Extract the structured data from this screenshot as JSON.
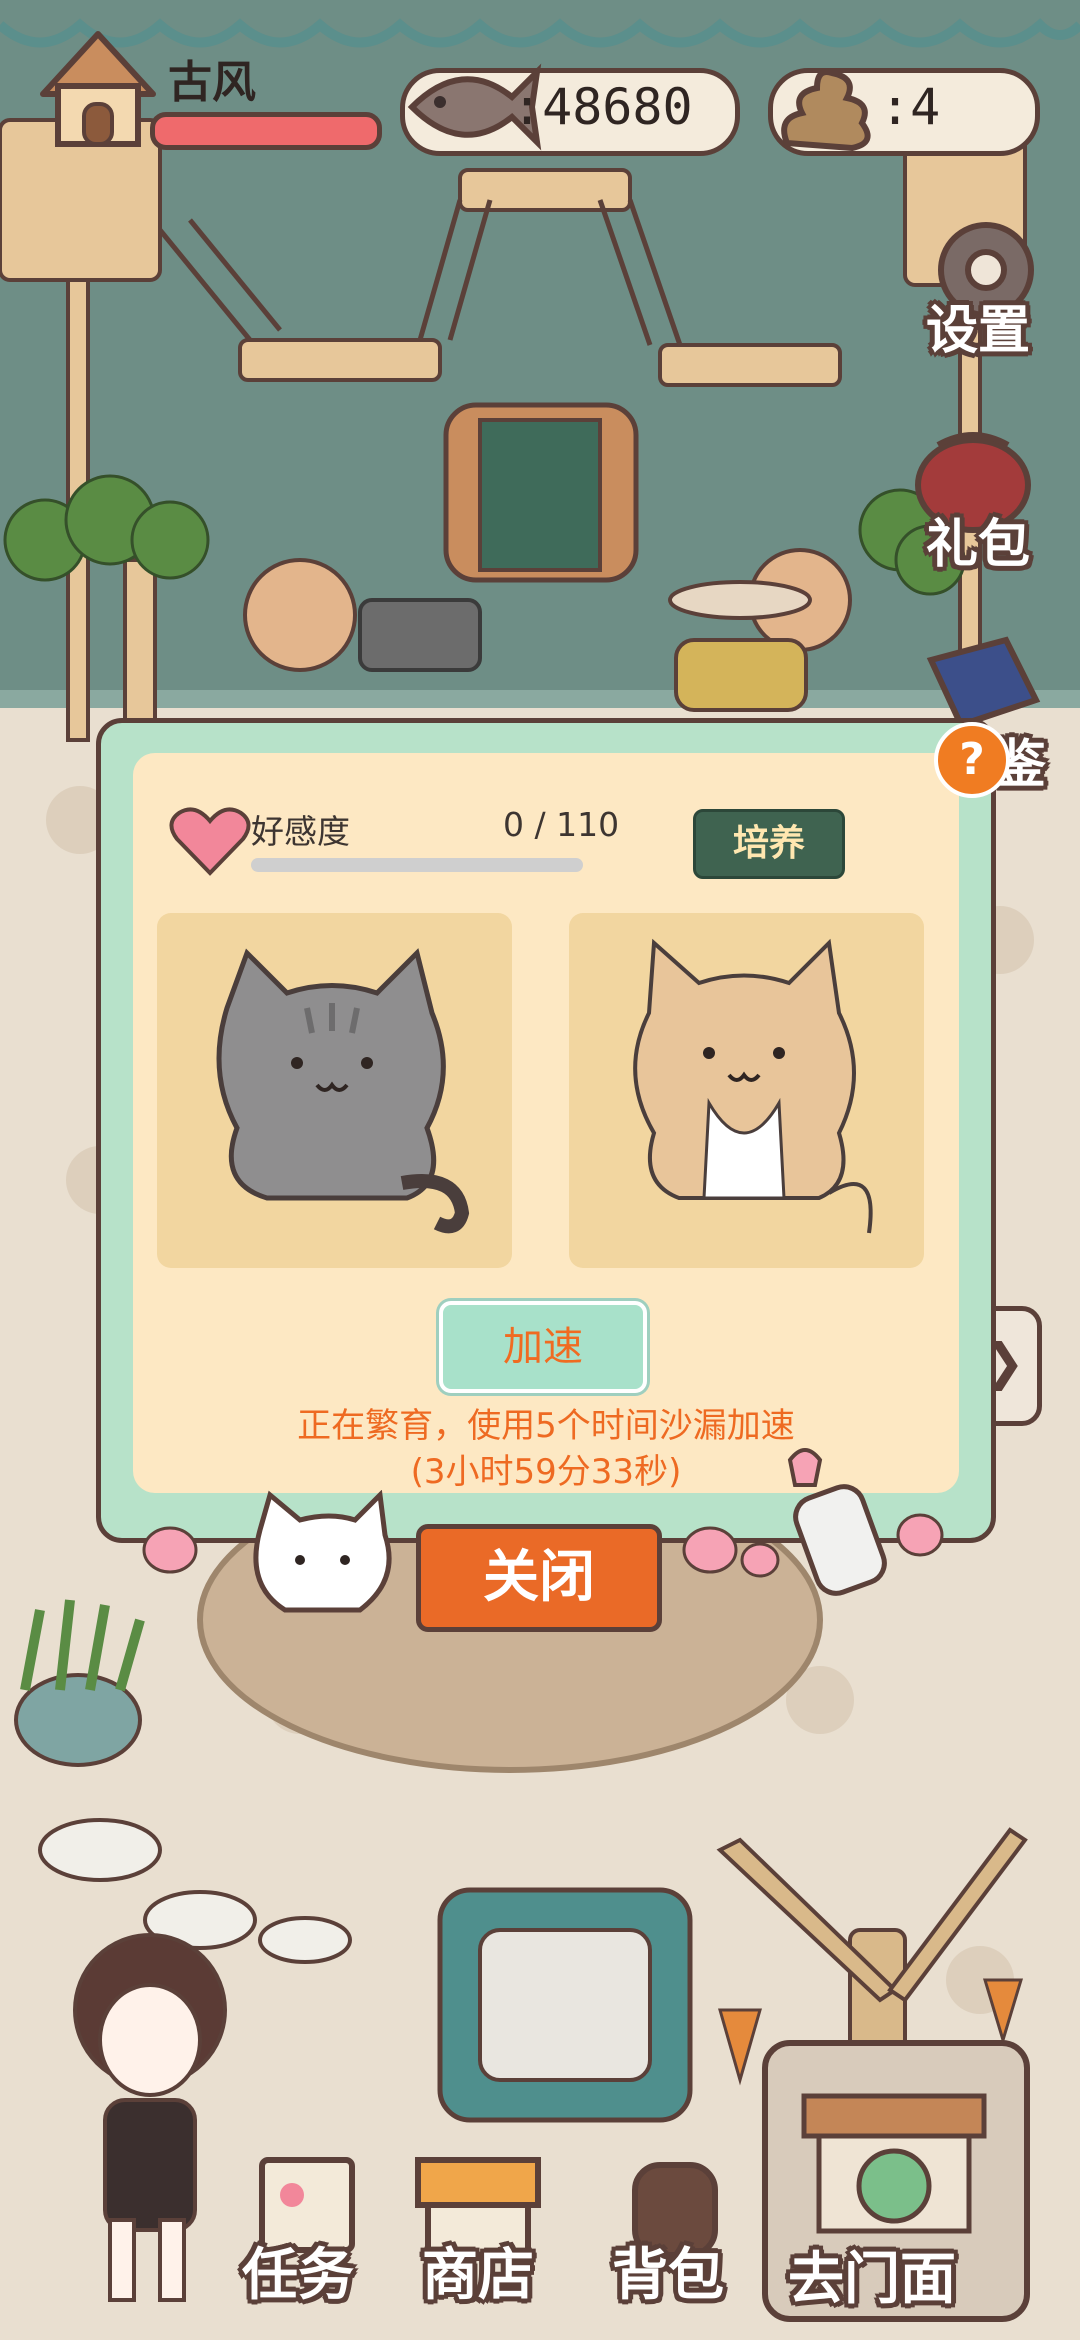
{
  "player": {
    "name": "古风"
  },
  "currency": {
    "fish": ":48680",
    "poop": ":4"
  },
  "side_menu": [
    {
      "label": "设置",
      "icon": "gear-icon"
    },
    {
      "label": "礼包",
      "icon": "gift-bag-icon"
    },
    {
      "label": "鉴",
      "icon": "book-icon"
    }
  ],
  "breeding_panel": {
    "affinity_label": "好感度",
    "affinity_value": "0 / 110",
    "affinity_progress": 0,
    "cultivate_label": "培养",
    "speedup_label": "加速",
    "status_line1": "正在繁育，使用5个时间沙漏加速",
    "status_line2": "(3小时59分33秒)",
    "help_label": "?",
    "close_label": "关闭"
  },
  "bottom_nav": [
    {
      "label": "任务",
      "icon": "task-scroll-icon"
    },
    {
      "label": "商店",
      "icon": "shop-awning-icon"
    },
    {
      "label": "背包",
      "icon": "backpack-icon"
    },
    {
      "label": "去门面",
      "icon": "storefront-icon"
    }
  ],
  "colors": {
    "outline": "#5b4039",
    "accent_orange": "#ea6a27",
    "panel_green": "#b7e2c9",
    "panel_cream": "#fde8c3",
    "health_bar": "#ef6a6c"
  }
}
